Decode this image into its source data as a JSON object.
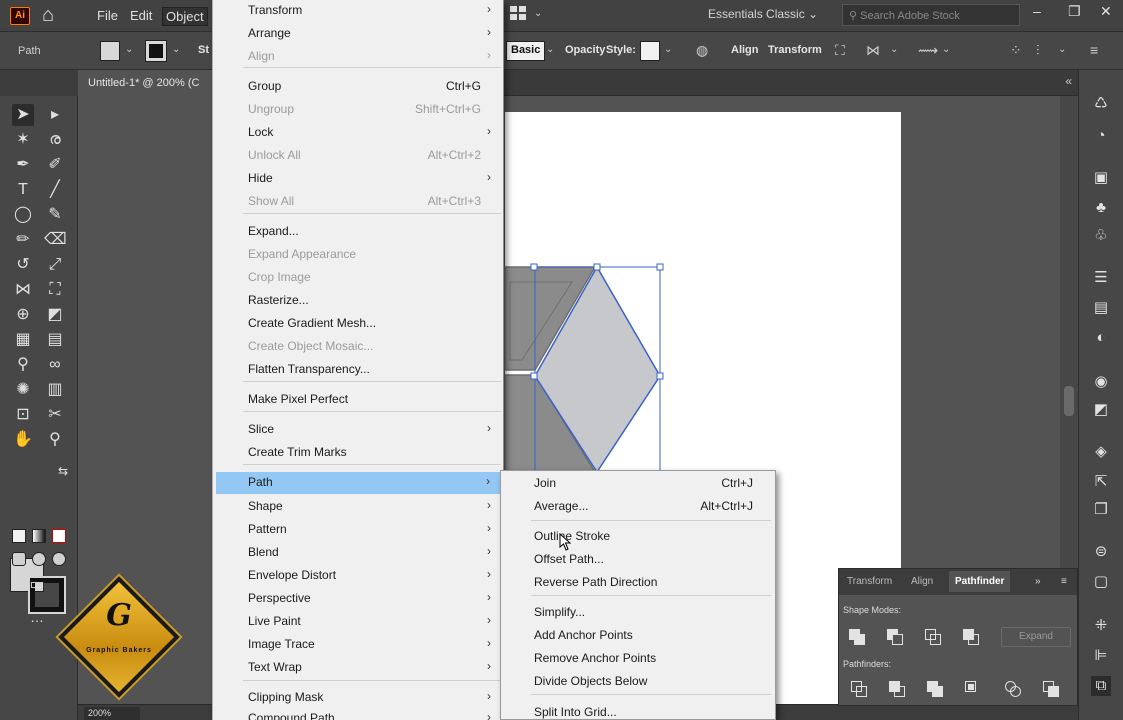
{
  "app": {
    "logo_text": "Ai",
    "menus": [
      "File",
      "Edit",
      "Object"
    ],
    "active_menu": "Object",
    "workspace": "Essentials Classic",
    "search_placeholder": "Search Adobe Stock"
  },
  "control_bar": {
    "selection_type": "Path",
    "style_text": "St",
    "brush_label": "Basic",
    "opacity_label": "Opacity",
    "style_label": "Style:",
    "align_label": "Align",
    "transform_label": "Transform"
  },
  "document": {
    "tab_title": "Untitled-1* @ 200% (C",
    "zoom": "200%"
  },
  "object_menu": {
    "items": [
      {
        "label": "Transform",
        "shortcut": "",
        "submenu": true,
        "disabled": false
      },
      {
        "label": "Arrange",
        "shortcut": "",
        "submenu": true,
        "disabled": false
      },
      {
        "label": "Align",
        "shortcut": "",
        "submenu": true,
        "disabled": true
      },
      {
        "label": "Group",
        "shortcut": "Ctrl+G",
        "submenu": false,
        "disabled": false
      },
      {
        "label": "Ungroup",
        "shortcut": "Shift+Ctrl+G",
        "submenu": false,
        "disabled": true
      },
      {
        "label": "Lock",
        "shortcut": "",
        "submenu": true,
        "disabled": false
      },
      {
        "label": "Unlock All",
        "shortcut": "Alt+Ctrl+2",
        "submenu": false,
        "disabled": true
      },
      {
        "label": "Hide",
        "shortcut": "",
        "submenu": true,
        "disabled": false
      },
      {
        "label": "Show All",
        "shortcut": "Alt+Ctrl+3",
        "submenu": false,
        "disabled": true
      },
      {
        "label": "Expand...",
        "shortcut": "",
        "submenu": false,
        "disabled": false
      },
      {
        "label": "Expand Appearance",
        "shortcut": "",
        "submenu": false,
        "disabled": true
      },
      {
        "label": "Crop Image",
        "shortcut": "",
        "submenu": false,
        "disabled": true
      },
      {
        "label": "Rasterize...",
        "shortcut": "",
        "submenu": false,
        "disabled": false
      },
      {
        "label": "Create Gradient Mesh...",
        "shortcut": "",
        "submenu": false,
        "disabled": false
      },
      {
        "label": "Create Object Mosaic...",
        "shortcut": "",
        "submenu": false,
        "disabled": true
      },
      {
        "label": "Flatten Transparency...",
        "shortcut": "",
        "submenu": false,
        "disabled": false
      },
      {
        "label": "Make Pixel Perfect",
        "shortcut": "",
        "submenu": false,
        "disabled": false
      },
      {
        "label": "Slice",
        "shortcut": "",
        "submenu": true,
        "disabled": false
      },
      {
        "label": "Create Trim Marks",
        "shortcut": "",
        "submenu": false,
        "disabled": false
      },
      {
        "label": "Path",
        "shortcut": "",
        "submenu": true,
        "disabled": false,
        "highlighted": true
      },
      {
        "label": "Shape",
        "shortcut": "",
        "submenu": true,
        "disabled": false
      },
      {
        "label": "Pattern",
        "shortcut": "",
        "submenu": true,
        "disabled": false
      },
      {
        "label": "Blend",
        "shortcut": "",
        "submenu": true,
        "disabled": false
      },
      {
        "label": "Envelope Distort",
        "shortcut": "",
        "submenu": true,
        "disabled": false
      },
      {
        "label": "Perspective",
        "shortcut": "",
        "submenu": true,
        "disabled": false
      },
      {
        "label": "Live Paint",
        "shortcut": "",
        "submenu": true,
        "disabled": false
      },
      {
        "label": "Image Trace",
        "shortcut": "",
        "submenu": true,
        "disabled": false
      },
      {
        "label": "Text Wrap",
        "shortcut": "",
        "submenu": true,
        "disabled": false
      },
      {
        "label": "Clipping Mask",
        "shortcut": "",
        "submenu": true,
        "disabled": false
      },
      {
        "label": "Compound Path",
        "shortcut": "",
        "submenu": true,
        "disabled": false
      }
    ]
  },
  "path_submenu": {
    "items": [
      {
        "label": "Join",
        "shortcut": "Ctrl+J"
      },
      {
        "label": "Average...",
        "shortcut": "Alt+Ctrl+J"
      },
      {
        "label": "Outline Stroke",
        "shortcut": ""
      },
      {
        "label": "Offset Path...",
        "shortcut": ""
      },
      {
        "label": "Reverse Path Direction",
        "shortcut": ""
      },
      {
        "label": "Simplify...",
        "shortcut": ""
      },
      {
        "label": "Add Anchor Points",
        "shortcut": ""
      },
      {
        "label": "Remove Anchor Points",
        "shortcut": ""
      },
      {
        "label": "Divide Objects Below",
        "shortcut": ""
      },
      {
        "label": "Split Into Grid...",
        "shortcut": ""
      }
    ]
  },
  "pathfinder_panel": {
    "tabs": [
      "Transform",
      "Align",
      "Pathfinder"
    ],
    "active_tab": "Pathfinder",
    "shape_modes_label": "Shape Modes:",
    "pathfinders_label": "Pathfinders:",
    "expand_label": "Expand"
  },
  "watermark": {
    "letter": "G",
    "text": "Graphic Bakers"
  },
  "colors": {
    "menu_bg": "#f0f0f0",
    "menu_highlight": "#94c8f4",
    "ui_dark": "#474747",
    "artboard": "#ffffff",
    "selection_blue": "#3a63c8",
    "badge_gold": "#e5b430"
  }
}
